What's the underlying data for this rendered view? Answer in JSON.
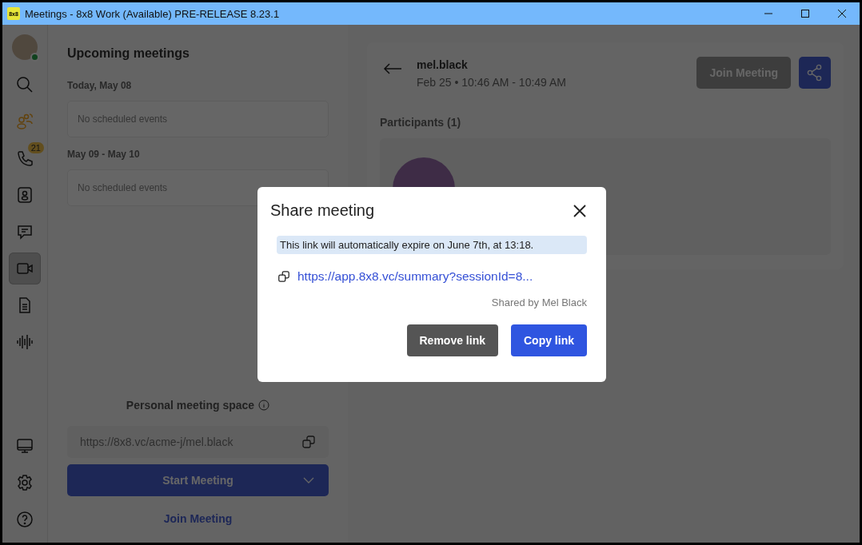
{
  "window": {
    "title": "Meetings - 8x8 Work (Available) PRE-RELEASE 8.23.1",
    "logo": "8x8"
  },
  "sidebar": {
    "items": [
      {
        "kind": "search",
        "selected": false
      },
      {
        "kind": "team",
        "selected": false
      },
      {
        "kind": "phone",
        "selected": false,
        "badge": "21"
      },
      {
        "kind": "contacts",
        "selected": false
      },
      {
        "kind": "chat",
        "selected": false
      },
      {
        "kind": "video",
        "selected": true
      },
      {
        "kind": "document",
        "selected": false
      },
      {
        "kind": "voicemail",
        "selected": false
      }
    ],
    "bottom_items": [
      {
        "kind": "monitor",
        "selected": false
      },
      {
        "kind": "settings",
        "selected": false
      },
      {
        "kind": "help",
        "selected": false
      }
    ]
  },
  "upcoming": {
    "title": "Upcoming meetings",
    "groups": [
      {
        "date": "Today, May 08",
        "empty_text": "No scheduled events"
      },
      {
        "date": "May 09 - May 10",
        "empty_text": "No scheduled events"
      }
    ]
  },
  "personal_space": {
    "label": "Personal meeting space",
    "url": "https://8x8.vc/acme-j/mel.black",
    "start_button": "Start Meeting",
    "join_link": "Join Meeting"
  },
  "meeting": {
    "host": "mel.black",
    "time": "Feb 25 • 10:46 AM - 10:49 AM",
    "join_button": "Join Meeting",
    "participants_heading": "Participants (1)"
  },
  "dialog": {
    "title": "Share meeting",
    "notice": "This link will automatically expire on June 7th, at 13:18.",
    "link": "https://app.8x8.vc/summary?sessionId=8...",
    "shared_by": "Shared by Mel Black",
    "buttons": [
      {
        "label": "Remove link",
        "kind": "secondary"
      },
      {
        "label": "Copy link",
        "kind": "primary"
      }
    ]
  }
}
